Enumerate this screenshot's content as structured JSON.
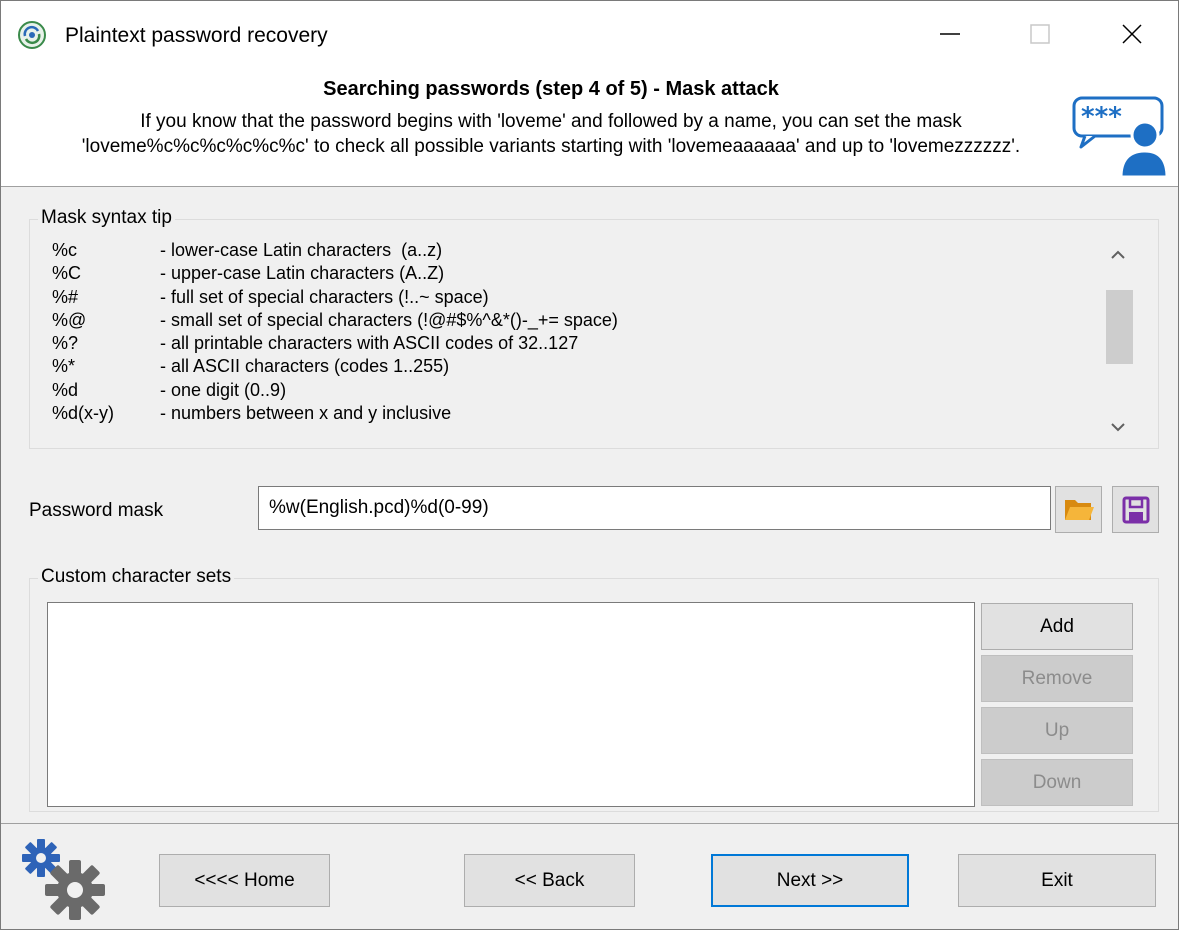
{
  "window": {
    "title": "Plaintext password recovery",
    "icons": {
      "app": "app-icon",
      "minimize": "minimize-icon",
      "maximize": "maximize-icon",
      "close": "close-icon"
    }
  },
  "header": {
    "title": "Searching passwords (step 4 of 5) - Mask attack",
    "description": "If you know that the password begins with 'loveme' and followed by a name, you can set the mask 'loveme%c%c%c%c%c%c' to check all possible variants starting with 'lovemeaaaaaa' and up to 'lovemezzzzzz'.",
    "icon": "password-user-icon"
  },
  "mask_tip": {
    "label": "Mask syntax tip",
    "rows": [
      {
        "code": "%c",
        "desc": "- lower-case Latin characters  (a..z)"
      },
      {
        "code": "%C",
        "desc": "- upper-case Latin characters (A..Z)"
      },
      {
        "code": "%#",
        "desc": "- full set of special characters (!..~ space)"
      },
      {
        "code": "%@",
        "desc": "- small set of special characters (!@#$%^&*()-_+= space)"
      },
      {
        "code": "%?",
        "desc": "- all printable characters with ASCII codes of 32..127"
      },
      {
        "code": "%*",
        "desc": "- all ASCII characters (codes 1..255)"
      },
      {
        "code": "%d",
        "desc": "- one digit (0..9)"
      },
      {
        "code": "%d(x-y)",
        "desc": "- numbers between x and y inclusive"
      }
    ]
  },
  "password_mask": {
    "label": "Password mask",
    "value": "%w(English.pcd)%d(0-99)",
    "open_icon": "folder-open-icon",
    "save_icon": "floppy-save-icon"
  },
  "custom_sets": {
    "label": "Custom character sets",
    "buttons": {
      "add": "Add",
      "remove": "Remove",
      "up": "Up",
      "down": "Down"
    }
  },
  "footer": {
    "gears_icon": "gears-icon",
    "home": "<<<< Home",
    "back": "<< Back",
    "next": "Next >>",
    "exit": "Exit"
  },
  "colors": {
    "accent": "#0078d7",
    "header_icon": "#1e6fc4",
    "folder": "#f0a020",
    "save": "#7b2fa8"
  }
}
